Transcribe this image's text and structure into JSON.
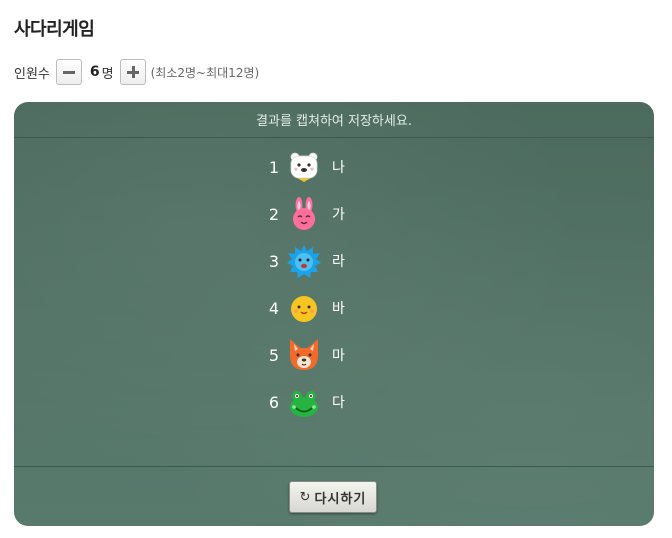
{
  "game": {
    "title": "사다리게임"
  },
  "participants": {
    "label": "인원수",
    "value": "6",
    "unit": "명",
    "range": "(최소2명~최대12명)"
  },
  "board": {
    "header": "결과를 캡쳐하여 저장하세요.",
    "results": [
      {
        "rank": "1",
        "avatar": "polar-bear-icon",
        "name": "나"
      },
      {
        "rank": "2",
        "avatar": "bunny-icon",
        "name": "가"
      },
      {
        "rank": "3",
        "avatar": "hedgehog-icon",
        "name": "라"
      },
      {
        "rank": "4",
        "avatar": "chick-icon",
        "name": "바"
      },
      {
        "rank": "5",
        "avatar": "fox-icon",
        "name": "마"
      },
      {
        "rank": "6",
        "avatar": "frog-icon",
        "name": "다"
      }
    ],
    "retry_label": "다시하기"
  },
  "colors": {
    "board_bg": "#4f6f62",
    "text_light": "#ffffff"
  }
}
